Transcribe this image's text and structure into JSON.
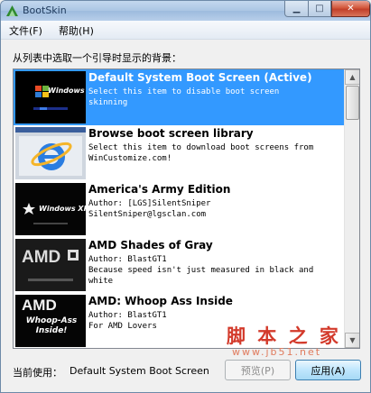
{
  "window": {
    "title": "BootSkin"
  },
  "menu": {
    "file": "文件(F)",
    "help": "帮助(H)"
  },
  "instruction": "从列表中选取一个引导时显示的背景：",
  "boot_screens": [
    {
      "title": "Default System Boot Screen (Active)",
      "lines": [
        "Select this item to disable boot screen",
        "skinning"
      ],
      "thumb_text": "Windows XP",
      "selected": true
    },
    {
      "title": "Browse boot screen library",
      "lines": [
        "Select this item to download boot screens from",
        "WinCustomize.com!"
      ],
      "thumb_text": "",
      "selected": false
    },
    {
      "title": "America's Army Edition",
      "lines": [
        "Author: [LGS]SilentSniper",
        "SilentSniper@lgsclan.com"
      ],
      "thumb_text": "Windows XP",
      "selected": false
    },
    {
      "title": "AMD Shades of Gray",
      "lines": [
        "Author: BlastGT1",
        "Because speed isn't just measured in black and",
        "white"
      ],
      "thumb_text": "AMD",
      "selected": false
    },
    {
      "title": "AMD: Whoop Ass Inside",
      "lines": [
        "Author: BlastGT1",
        "For AMD Lovers"
      ],
      "thumb_text": "AMD",
      "thumb_sub": "Whoop-Ass Inside!",
      "selected": false
    }
  ],
  "footer": {
    "current_label": "当前使用：",
    "current_value": "Default System Boot Screen",
    "preview_button": "预览(P)",
    "apply_button": "应用(A)"
  },
  "watermark": {
    "text": "脚 本 之 家",
    "url": "www.jb51.net"
  },
  "colors": {
    "selection": "#3399ff",
    "watermark": "#d33a2b"
  }
}
